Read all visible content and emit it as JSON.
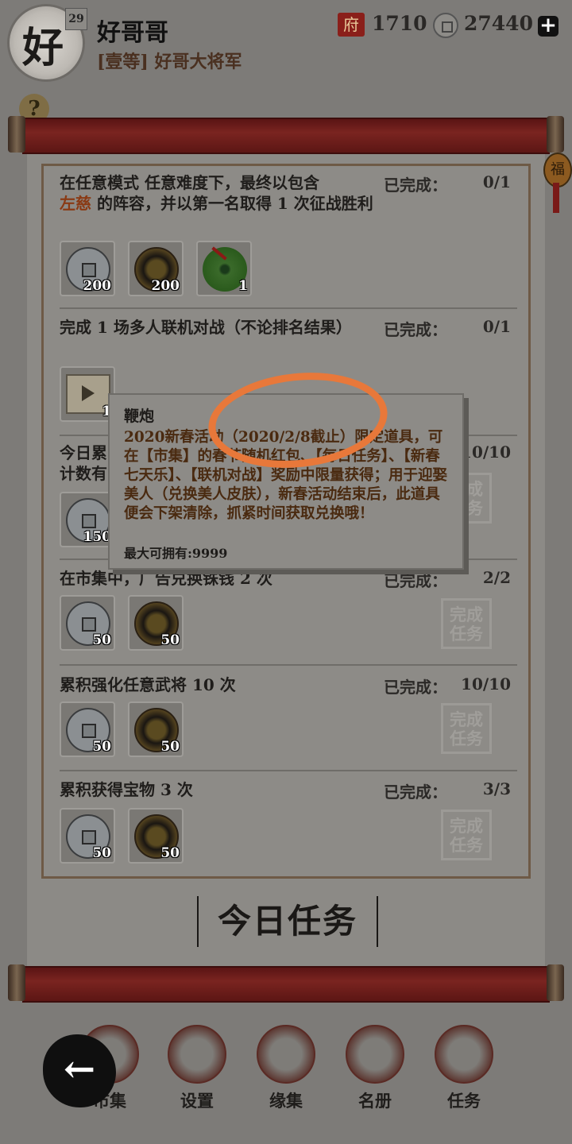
{
  "player": {
    "avatar_char": "好",
    "level": "29",
    "name": "好哥哥",
    "title": "[壹等] 好哥大将军"
  },
  "resources": {
    "res1_icon_char": "府",
    "res1_value": "1710",
    "coins_value": "27440",
    "plus_label": "+"
  },
  "help_label": "?",
  "charm_char": "福",
  "status_label": "已完成：",
  "tasks": [
    {
      "desc_pre": "在任意模式 任意难度下，最终以包含",
      "desc_highlight": "左慈",
      "desc_post": " 的阵容，并以第一名取得 1 次征战胜利",
      "progress": "0/1",
      "rewards": [
        {
          "type": "silver-coin-icon",
          "qty": "200"
        },
        {
          "type": "gold-coin-icon",
          "qty": "200"
        },
        {
          "type": "jade-icon",
          "qty": "1"
        }
      ]
    },
    {
      "desc": "完成 1 场多人联机对战（不论排名结果）",
      "progress": "0/1",
      "rewards": [
        {
          "type": "firecracker-ticket-icon",
          "qty": "1"
        }
      ]
    },
    {
      "desc": "今日累",
      "desc2": "计数有",
      "progress": "10/10",
      "stamp": "完成任务",
      "rewards": [
        {
          "type": "silver-coin-icon",
          "qty": "150"
        }
      ]
    },
    {
      "desc": "在市集中，广告兑换铢钱 2 次",
      "progress": "2/2",
      "stamp": "完成任务",
      "rewards": [
        {
          "type": "silver-coin-icon",
          "qty": "50"
        },
        {
          "type": "gold-coin-icon",
          "qty": "50"
        }
      ]
    },
    {
      "desc": "累积强化任意武将 10 次",
      "progress": "10/10",
      "stamp": "完成任务",
      "rewards": [
        {
          "type": "silver-coin-icon",
          "qty": "50"
        },
        {
          "type": "gold-coin-icon",
          "qty": "50"
        }
      ]
    },
    {
      "desc": "累积获得宝物 3 次",
      "progress": "3/3",
      "stamp": "完成任务",
      "rewards": [
        {
          "type": "silver-coin-icon",
          "qty": "50"
        },
        {
          "type": "gold-coin-icon",
          "qty": "50"
        }
      ]
    }
  ],
  "stamp_line1": "完成",
  "stamp_line2": "任务",
  "banner": "今日任务",
  "tooltip": {
    "title": "鞭炮",
    "desc": "2020新春活动（2020/2/8截止）限定道具，可在【市集】的春节随机红包、【每日任务】、【新春七天乐】、【联机对战】奖励中限量获得；用于迎娶美人（兑换美人皮肤），新春活动结束后，此道具便会下架清除，抓紧时间获取兑换哦！",
    "max": "最大可拥有:9999"
  },
  "nav": {
    "back_label": "←",
    "items": [
      "市集",
      "设置",
      "缘集",
      "名册",
      "任务"
    ]
  },
  "colors": {
    "annotation": "#e8783a",
    "scroll": "#7a2420"
  }
}
